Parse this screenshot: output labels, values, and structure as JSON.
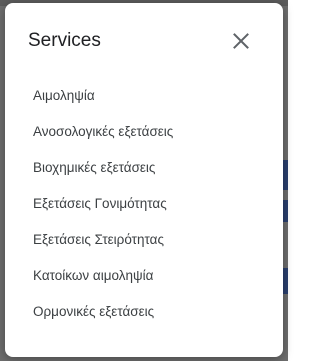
{
  "dialog": {
    "title": "Services",
    "close_icon": "close-icon"
  },
  "services": [
    {
      "label": "Αιμοληψία"
    },
    {
      "label": "Ανοσολογικές εξετάσεις"
    },
    {
      "label": "Βιοχημικές εξετάσεις"
    },
    {
      "label": "Εξετάσεις Γονιμότητας"
    },
    {
      "label": "Εξετάσεις Στειρότητας"
    },
    {
      "label": "Κατοίκων αιμοληψία"
    },
    {
      "label": "Ορμονικές εξετάσεις"
    }
  ],
  "colors": {
    "backdrop": "#6e6e6e",
    "dialog_bg": "#ffffff",
    "title_text": "#202124",
    "item_text": "#3c4043",
    "icon": "#5f6368"
  }
}
